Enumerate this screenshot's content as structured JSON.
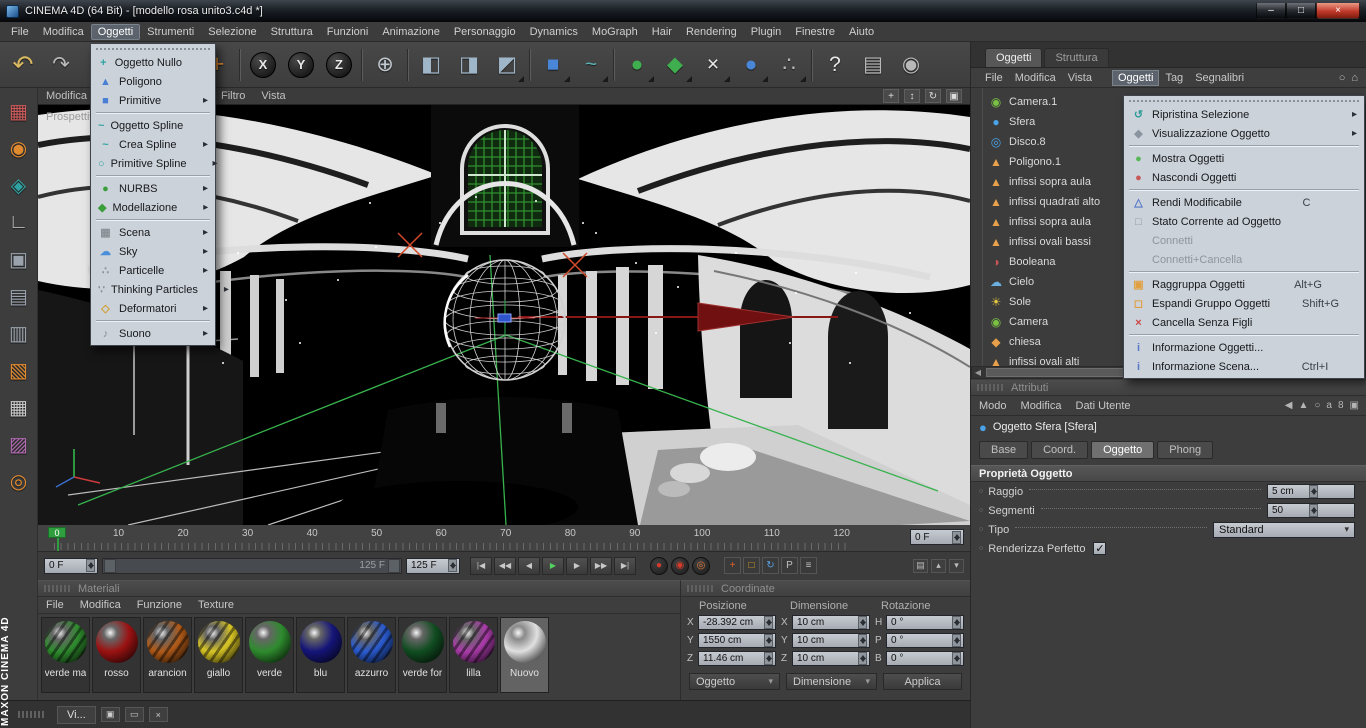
{
  "titlebar": {
    "title": "CINEMA 4D (64 Bit) - [modello rosa unito3.c4d *]",
    "minimize": "–",
    "maximize": "□",
    "close": "×"
  },
  "menubar": {
    "items": [
      {
        "label": "File"
      },
      {
        "label": "Modifica"
      },
      {
        "label": "Oggetti",
        "open": true
      },
      {
        "label": "Strumenti"
      },
      {
        "label": "Selezione"
      },
      {
        "label": "Struttura"
      },
      {
        "label": "Funzioni"
      },
      {
        "label": "Animazione"
      },
      {
        "label": "Personaggio"
      },
      {
        "label": "Dynamics"
      },
      {
        "label": "MoGraph"
      },
      {
        "label": "Hair"
      },
      {
        "label": "Rendering"
      },
      {
        "label": "Plugin"
      },
      {
        "label": "Finestre"
      },
      {
        "label": "Aiuto"
      }
    ]
  },
  "app_menu": {
    "items": [
      {
        "label": "Oggetto Nullo",
        "glyph": "+",
        "color": "#2fa3a3"
      },
      {
        "label": "Poligono",
        "glyph": "▲",
        "color": "#4a7fd6"
      },
      {
        "label": "Primitive",
        "glyph": "■",
        "color": "#4a7fd6",
        "submenu": true,
        "sep_after": true
      },
      {
        "label": "Oggetto Spline",
        "glyph": "~",
        "color": "#2fa3a3"
      },
      {
        "label": "Crea Spline",
        "glyph": "~",
        "color": "#2fa3a3",
        "submenu": true
      },
      {
        "label": "Primitive Spline",
        "glyph": "○",
        "color": "#2fa3a3",
        "submenu": true,
        "sep_after": true
      },
      {
        "label": "NURBS",
        "glyph": "●",
        "color": "#3a9e3a",
        "submenu": true
      },
      {
        "label": "Modellazione",
        "glyph": "◆",
        "color": "#3a9e3a",
        "submenu": true,
        "sep_after": true
      },
      {
        "label": "Scena",
        "glyph": "▦",
        "color": "#8a8f96",
        "submenu": true
      },
      {
        "label": "Sky",
        "glyph": "☁",
        "color": "#4a90d8",
        "submenu": true
      },
      {
        "label": "Particelle",
        "glyph": "∴",
        "color": "#8a8f96",
        "submenu": true
      },
      {
        "label": "Thinking Particles",
        "glyph": "∵",
        "color": "#8a8f96",
        "submenu": true
      },
      {
        "label": "Deformatori",
        "glyph": "◇",
        "color": "#d0a030",
        "submenu": true,
        "sep_after": true
      },
      {
        "label": "Suono",
        "glyph": "♪",
        "color": "#8a8f96",
        "submenu": true
      }
    ]
  },
  "toolbar": {
    "items": [
      {
        "name": "undo-button",
        "glyph": "↶",
        "color": "#d8b860",
        "big": true
      },
      {
        "name": "redo-button",
        "glyph": "↷",
        "color": "#b8b8b8"
      },
      {
        "spacer": true,
        "interactable": "false"
      },
      {
        "name": "move-tool-button",
        "glyph": "+",
        "color": "#e08a30",
        "big": true
      },
      {
        "sep": true,
        "interactable": "false"
      },
      {
        "name": "lock-x-button",
        "glyph": "X",
        "color": "#e8e8e8",
        "circle": true
      },
      {
        "name": "lock-y-button",
        "glyph": "Y",
        "color": "#e8e8e8",
        "circle": true
      },
      {
        "name": "lock-z-button",
        "glyph": "Z",
        "color": "#e8e8e8",
        "circle": true
      },
      {
        "sep": true,
        "interactable": "false"
      },
      {
        "name": "coordinate-system-button",
        "glyph": "⊕",
        "color": "#c0c8d0"
      },
      {
        "sep": true,
        "interactable": "false"
      },
      {
        "name": "render-view-button",
        "glyph": "◧",
        "color": "#9fb6c8"
      },
      {
        "name": "render-region-button",
        "glyph": "◨",
        "color": "#9fb6c8"
      },
      {
        "name": "render-settings-button",
        "glyph": "◩",
        "color": "#9fb6c8",
        "dropdown": true
      },
      {
        "sep": true,
        "interactable": "false"
      },
      {
        "name": "primitives-dropdown",
        "glyph": "■",
        "color": "#4a86d8",
        "dropdown": true
      },
      {
        "name": "splines-dropdown",
        "glyph": "~",
        "color": "#58b0b0",
        "dropdown": true
      },
      {
        "sep": true,
        "interactable": "false"
      },
      {
        "name": "nurbs-dropdown",
        "glyph": "●",
        "color": "#3fae4f",
        "dropdown": true
      },
      {
        "name": "modeling-dropdown",
        "glyph": "◆",
        "color": "#3fae4f",
        "dropdown": true
      },
      {
        "name": "instance-dropdown",
        "glyph": "×",
        "color": "#e8e8e8",
        "dropdown": true
      },
      {
        "name": "deformers-dropdown",
        "glyph": "●",
        "color": "#4a86d8",
        "dropdown": true
      },
      {
        "name": "particles-dropdown",
        "glyph": "∴",
        "color": "#b8b8b8",
        "dropdown": true
      },
      {
        "sep": true,
        "interactable": "false"
      },
      {
        "name": "help-button",
        "glyph": "?",
        "color": "#e8e8e8"
      },
      {
        "name": "content-browser-button",
        "glyph": "▤",
        "color": "#b8b8b8"
      },
      {
        "name": "online-globe-button",
        "glyph": "◉",
        "color": "#b8b8b8"
      }
    ]
  },
  "left_toolbar": {
    "items": [
      {
        "name": "layout-palette-icon",
        "glyph": "▦",
        "color": "#cc5a5a"
      },
      {
        "name": "model-mode-icon",
        "glyph": "◉",
        "color": "#e08a30"
      },
      {
        "name": "texture-tool-icon",
        "glyph": "◈",
        "color": "#2fa3a3"
      },
      {
        "name": "workplane-icon",
        "glyph": "∟",
        "color": "#b8b8b8"
      },
      {
        "name": "points-mode-icon",
        "glyph": "▣",
        "color": "#9aa3ad"
      },
      {
        "name": "edges-mode-icon",
        "glyph": "▤",
        "color": "#9aa3ad"
      },
      {
        "name": "polygons-mode-icon",
        "glyph": "▥",
        "color": "#9aa3ad"
      },
      {
        "name": "object-axis-icon",
        "glyph": "▧",
        "color": "#e08a30"
      },
      {
        "name": "grid-mode-icon",
        "glyph": "▦",
        "color": "#c8c8c8"
      },
      {
        "name": "texture-axis-icon",
        "glyph": "▨",
        "color": "#b06ab0"
      },
      {
        "name": "snap-settings-icon",
        "glyph": "◎",
        "color": "#e08a30"
      }
    ]
  },
  "viewport": {
    "menu": [
      {
        "label": "Modifica"
      },
      {
        "label": "Filtro",
        "gap": true
      },
      {
        "label": "Vista"
      }
    ],
    "view_label": "Prospettiva",
    "nav": [
      {
        "name": "pan-view-icon",
        "glyph": "+"
      },
      {
        "name": "dolly-view-icon",
        "glyph": "↕"
      },
      {
        "name": "rotate-view-icon",
        "glyph": "↻"
      },
      {
        "name": "toggle-view-icon",
        "glyph": "▣"
      }
    ]
  },
  "timeline": {
    "ticks": [
      "0",
      "10",
      "20",
      "30",
      "40",
      "50",
      "60",
      "70",
      "80",
      "90",
      "100",
      "110",
      "120"
    ],
    "marker": "0",
    "ruler_frame": "0 F",
    "current_frame": "0 F",
    "range_label": "125 F",
    "end_frame": "125 F",
    "transport": [
      {
        "name": "goto-start-button",
        "glyph": "|◀"
      },
      {
        "name": "prev-key-button",
        "glyph": "◀◀"
      },
      {
        "name": "prev-frame-button",
        "glyph": "◀"
      },
      {
        "name": "play-button",
        "glyph": "▶",
        "green": true
      },
      {
        "name": "next-frame-button",
        "glyph": "▶"
      },
      {
        "name": "next-key-button",
        "glyph": "▶▶"
      },
      {
        "name": "goto-end-button",
        "glyph": "▶|"
      }
    ],
    "record": [
      {
        "name": "record-keyframe-button",
        "glyph": "●",
        "color": "#d43b2a"
      },
      {
        "name": "autokeying-button",
        "glyph": "◉",
        "color": "#d43b2a"
      },
      {
        "name": "keyframe-selection-button",
        "glyph": "◎",
        "color": "#e07a3a"
      }
    ],
    "toggles": [
      {
        "name": "record-position-toggle",
        "glyph": "+",
        "color": "#e06020"
      },
      {
        "name": "record-scale-toggle",
        "glyph": "□",
        "color": "#e0a020"
      },
      {
        "name": "record-rotation-toggle",
        "glyph": "↻",
        "color": "#58a0e0"
      },
      {
        "name": "record-parameter-toggle",
        "glyph": "P",
        "color": "#c0c0c0"
      },
      {
        "name": "record-pla-toggle",
        "glyph": "≡",
        "color": "#c0c0c0"
      }
    ],
    "extra": [
      {
        "name": "timeline-layout-icon",
        "glyph": "▤"
      },
      {
        "name": "timeline-up-icon",
        "glyph": "▴"
      },
      {
        "name": "timeline-expand-icon",
        "glyph": "▾"
      }
    ]
  },
  "materials": {
    "title": "Materiali",
    "menu": [
      "File",
      "Modifica",
      "Funzione",
      "Texture"
    ],
    "items": [
      {
        "name": "verde ma",
        "color": "#2e8b2e",
        "striped": true
      },
      {
        "name": "rosso",
        "color": "#9b1212"
      },
      {
        "name": "arancion",
        "color": "#b05a18",
        "striped": true
      },
      {
        "name": "giallo",
        "color": "#d8c525",
        "striped": true
      },
      {
        "name": "verde",
        "color": "#2e8b2e"
      },
      {
        "name": "blu",
        "color": "#15157a"
      },
      {
        "name": "azzurro",
        "color": "#2a5bd0",
        "striped": true
      },
      {
        "name": "verde for",
        "color": "#114d21"
      },
      {
        "name": "lilla",
        "color": "#a93ba9",
        "striped": true
      },
      {
        "name": "Nuovo",
        "color": "#e0e0e0",
        "selected": true
      }
    ]
  },
  "coordinates": {
    "title": "Coordinate",
    "headers": [
      "Posizione",
      "Dimensione",
      "Rotazione"
    ],
    "cells": [
      {
        "axis": "X",
        "value": "-28.392 cm"
      },
      {
        "axis": "X",
        "value": "10 cm"
      },
      {
        "axis": "H",
        "value": "0 °"
      },
      {
        "axis": "Y",
        "value": "1550 cm"
      },
      {
        "axis": "Y",
        "value": "10 cm"
      },
      {
        "axis": "P",
        "value": "0 °"
      },
      {
        "axis": "Z",
        "value": "11.46 cm"
      },
      {
        "axis": "Z",
        "value": "10 cm"
      },
      {
        "axis": "B",
        "value": "0 °"
      }
    ],
    "mode_left": "Oggetto",
    "mode_mid": "Dimensione",
    "apply": "Applica"
  },
  "object_manager": {
    "tabs": [
      {
        "label": "Oggetti",
        "active": true
      },
      {
        "label": "Struttura"
      }
    ],
    "menu": [
      {
        "label": "File"
      },
      {
        "label": "Modifica"
      },
      {
        "label": "Vista"
      },
      {
        "label": "Oggetti",
        "open": true,
        "gap": true
      },
      {
        "label": "Tag"
      },
      {
        "label": "Segnalibri"
      }
    ],
    "icons": [
      {
        "name": "search-icon",
        "glyph": "○"
      },
      {
        "name": "home-icon",
        "glyph": "⌂"
      }
    ],
    "objects": [
      {
        "name": "Camera.1",
        "glyph": "◉",
        "color": "#7ac043"
      },
      {
        "name": "Sfera",
        "glyph": "●",
        "color": "#4aa3e8"
      },
      {
        "name": "Disco.8",
        "glyph": "◎",
        "color": "#4aa3e8"
      },
      {
        "name": "Poligono.1",
        "glyph": "▲",
        "color": "#e8a04a"
      },
      {
        "name": "infissi sopra aula",
        "glyph": "▲",
        "color": "#e8a04a"
      },
      {
        "name": "infissi quadrati alto",
        "glyph": "▲",
        "color": "#e8a04a"
      },
      {
        "name": "infissi sopra aula",
        "glyph": "▲",
        "color": "#e8a04a"
      },
      {
        "name": "infissi ovali bassi",
        "glyph": "▲",
        "color": "#e8a04a"
      },
      {
        "name": "Booleana",
        "glyph": "◑",
        "color": "#cc5555"
      },
      {
        "name": "Cielo",
        "glyph": "☁",
        "color": "#6ab0e0"
      },
      {
        "name": "Sole",
        "glyph": "☀",
        "color": "#e8c840"
      },
      {
        "name": "Camera",
        "glyph": "◉",
        "color": "#7ac043"
      },
      {
        "name": "chiesa",
        "glyph": "◆",
        "color": "#e8a04a"
      },
      {
        "name": "infissi ovali alti",
        "glyph": "▲",
        "color": "#e8a04a"
      }
    ]
  },
  "om_menu": {
    "items": [
      {
        "label": "Ripristina Selezione",
        "glyph": "↺",
        "color": "#2f9a9a",
        "submenu": true
      },
      {
        "label": "Visualizzazione Oggetto",
        "glyph": "◆",
        "color": "#8a94a0",
        "submenu": true,
        "sep_after": true
      },
      {
        "label": "Mostra Oggetti",
        "glyph": "●",
        "color": "#58b858"
      },
      {
        "label": "Nascondi Oggetti",
        "glyph": "●",
        "color": "#c85858",
        "sep_after": true
      },
      {
        "label": "Rendi Modificabile",
        "shortcut": "C",
        "glyph": "△",
        "color": "#5878c8"
      },
      {
        "label": "Stato Corrente ad Oggetto",
        "glyph": "□",
        "color": "#8a94a0"
      },
      {
        "label": "Connetti",
        "disabled": true
      },
      {
        "label": "Connetti+Cancella",
        "disabled": true,
        "sep_after": true
      },
      {
        "label": "Raggruppa Oggetti",
        "shortcut": "Alt+G",
        "glyph": "▣",
        "color": "#e0a040"
      },
      {
        "label": "Espandi Gruppo Oggetti",
        "shortcut": "Shift+G",
        "glyph": "◻",
        "color": "#e0a040"
      },
      {
        "label": "Cancella Senza Figli",
        "glyph": "×",
        "color": "#cc4444",
        "sep_after": true
      },
      {
        "label": "Informazione Oggetti...",
        "glyph": "i",
        "color": "#5878c8"
      },
      {
        "label": "Informazione Scena...",
        "shortcut": "Ctrl+I",
        "glyph": "i",
        "color": "#5878c8"
      }
    ]
  },
  "attributes": {
    "title": "Attributi",
    "menu": [
      "Modo",
      "Modifica",
      "Dati Utente"
    ],
    "icons": [
      {
        "name": "back-icon",
        "glyph": "◀"
      },
      {
        "name": "up-icon",
        "glyph": "▲"
      },
      {
        "name": "search-icon",
        "glyph": "○"
      },
      {
        "name": "aspect-lock-icon",
        "glyph": "a"
      },
      {
        "name": "filter-icon",
        "glyph": "8"
      },
      {
        "name": "layout-icon",
        "glyph": "▣"
      }
    ],
    "object_title": "Oggetto Sfera [Sfera]",
    "tabs": [
      {
        "label": "Base"
      },
      {
        "label": "Coord."
      },
      {
        "label": "Oggetto",
        "active": true
      },
      {
        "label": "Phong"
      }
    ],
    "section": "Proprietà Oggetto",
    "fields": [
      {
        "label": "Raggio",
        "value": "5 cm"
      },
      {
        "label": "Segmenti",
        "value": "50"
      },
      {
        "label": "Tipo",
        "value": "Standard"
      },
      {
        "label": "Renderizza Perfetto",
        "checked": true
      }
    ]
  },
  "bottom": {
    "tab_label": "Vi...",
    "brand": "MAXON CINEMA 4D"
  }
}
